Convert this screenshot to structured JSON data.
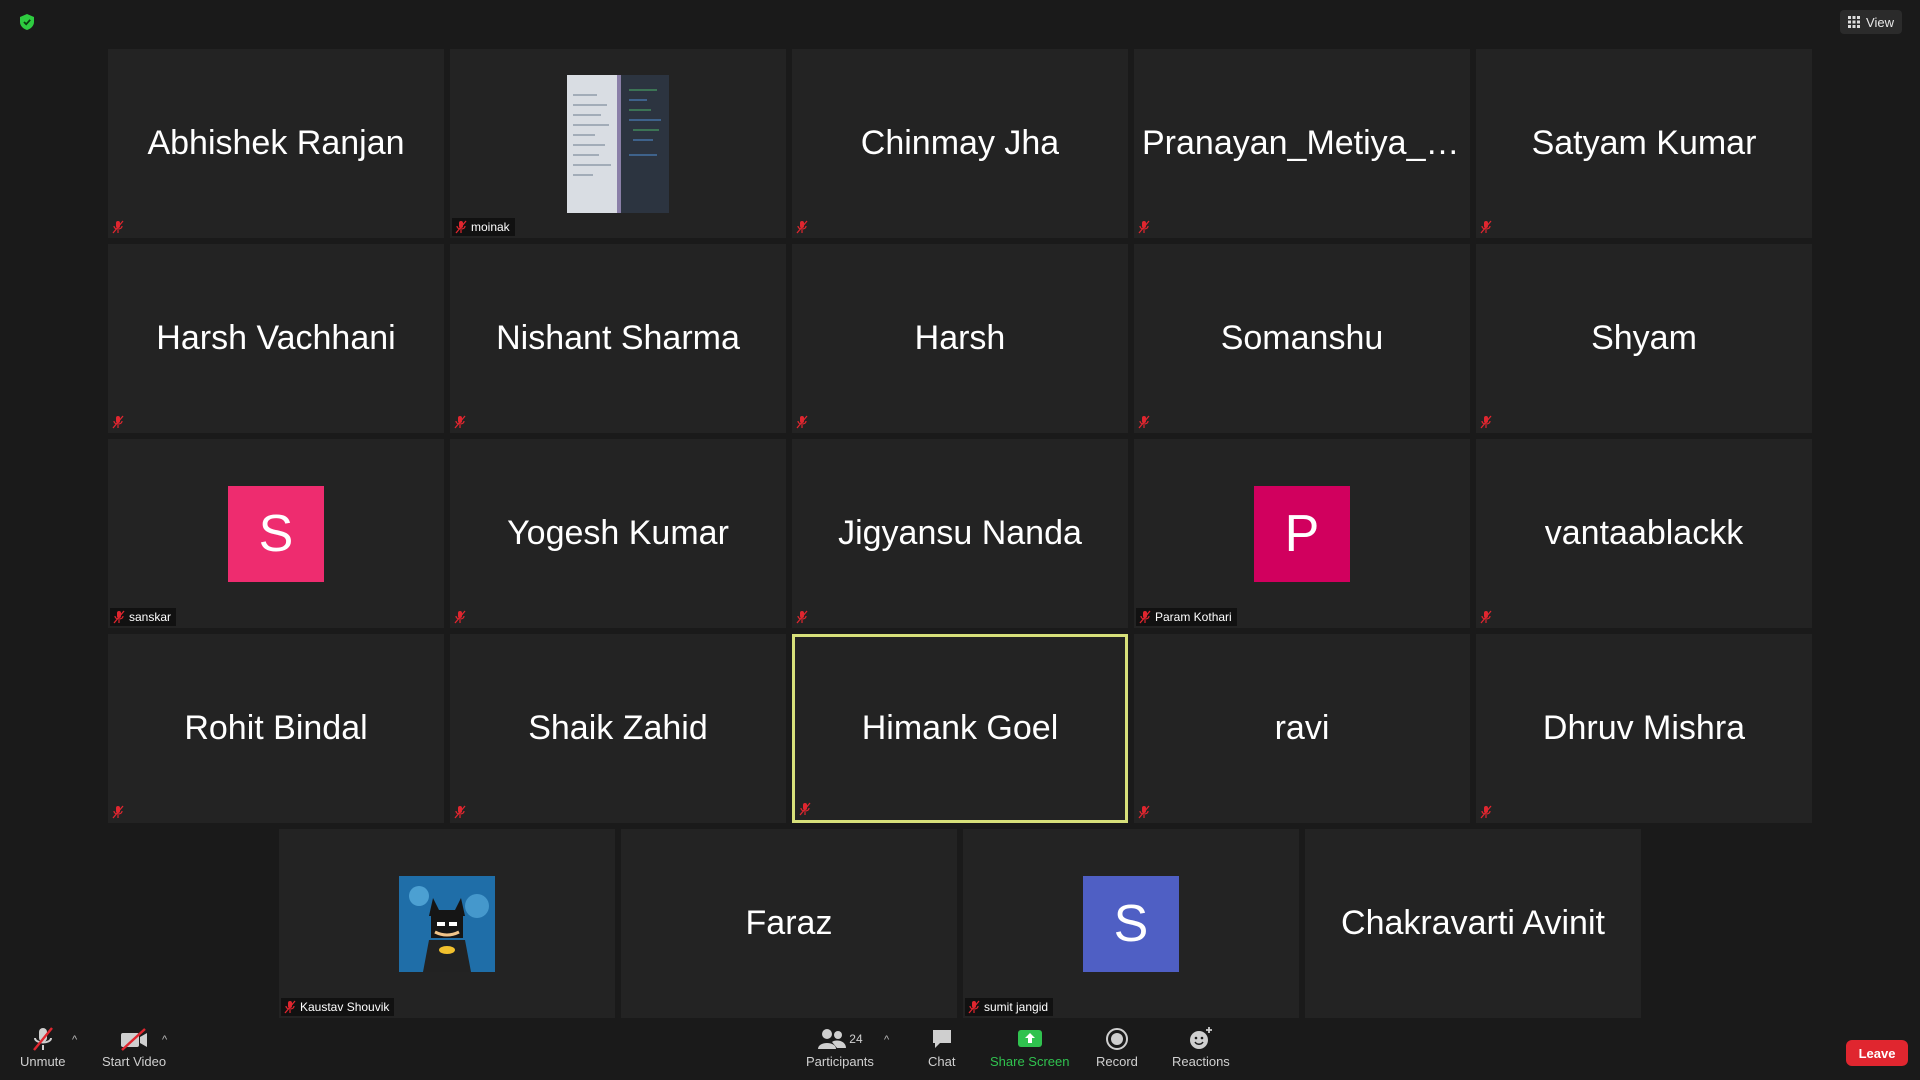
{
  "top_bar": {
    "view_label": "View",
    "shield_color": "#2ecc40"
  },
  "participants": [
    {
      "name": "Abhishek Ranjan",
      "label": "",
      "muted": true
    },
    {
      "name": "",
      "label": "moinak",
      "muted": true,
      "media": "screen-thumbnail"
    },
    {
      "name": "Chinmay Jha",
      "label": "",
      "muted": true
    },
    {
      "name": "Pranayan_Metiya_1...",
      "label": "",
      "muted": true
    },
    {
      "name": "Satyam Kumar",
      "label": "",
      "muted": true
    },
    {
      "name": "Harsh Vachhani",
      "label": "",
      "muted": true
    },
    {
      "name": "Nishant Sharma",
      "label": "",
      "muted": true
    },
    {
      "name": "Harsh",
      "label": "",
      "muted": true
    },
    {
      "name": "Somanshu",
      "label": "",
      "muted": true
    },
    {
      "name": "Shyam",
      "label": "",
      "muted": true
    },
    {
      "name": "",
      "label": "sanskar",
      "muted": true,
      "avatar": "S",
      "avatar_color": "#ee2c6f"
    },
    {
      "name": "Yogesh Kumar",
      "label": "",
      "muted": true
    },
    {
      "name": "Jigyansu Nanda",
      "label": "",
      "muted": true
    },
    {
      "name": "",
      "label": "Param Kothari",
      "muted": true,
      "avatar": "P",
      "avatar_color": "#d1005e"
    },
    {
      "name": "vantaablackk",
      "label": "",
      "muted": true
    },
    {
      "name": "Rohit Bindal",
      "label": "",
      "muted": true
    },
    {
      "name": "Shaik Zahid",
      "label": "",
      "muted": true
    },
    {
      "name": "Himank Goel",
      "label": "",
      "muted": true,
      "active": true
    },
    {
      "name": "ravi",
      "label": "",
      "muted": true
    },
    {
      "name": "Dhruv Mishra",
      "label": "",
      "muted": true
    },
    {
      "name": "",
      "label": "Kaustav Shouvik",
      "muted": true,
      "media": "batman-avatar"
    },
    {
      "name": "Faraz",
      "label": "",
      "muted": false
    },
    {
      "name": "",
      "label": "sumit jangid",
      "muted": true,
      "avatar": "S",
      "avatar_color": "#4f5fc4"
    },
    {
      "name": "Chakravarti Avinit",
      "label": "",
      "muted": false
    }
  ],
  "toolbar": {
    "unmute_label": "Unmute",
    "start_video_label": "Start Video",
    "participants_label": "Participants",
    "participants_count": "24",
    "chat_label": "Chat",
    "share_screen_label": "Share Screen",
    "record_label": "Record",
    "reactions_label": "Reactions",
    "leave_label": "Leave",
    "share_color": "#30c24f",
    "leave_color": "#e0262f"
  }
}
